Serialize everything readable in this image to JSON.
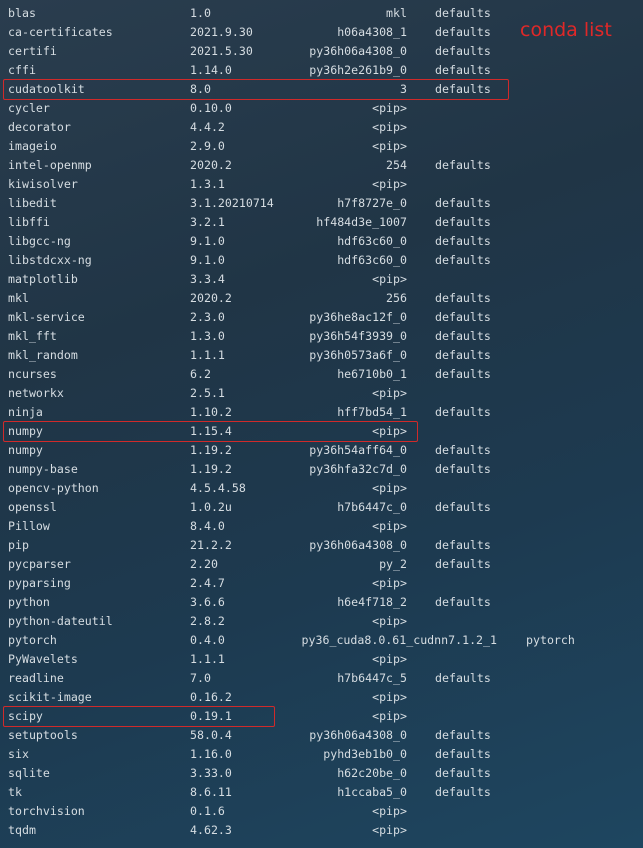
{
  "caption": "conda list",
  "packages": [
    {
      "name": "blas",
      "version": "1.0",
      "build": "mkl",
      "channel": "defaults"
    },
    {
      "name": "ca-certificates",
      "version": "2021.9.30",
      "build": "h06a4308_1",
      "channel": "defaults"
    },
    {
      "name": "certifi",
      "version": "2021.5.30",
      "build": "py36h06a4308_0",
      "channel": "defaults"
    },
    {
      "name": "cffi",
      "version": "1.14.0",
      "build": "py36h2e261b9_0",
      "channel": "defaults"
    },
    {
      "name": "cudatoolkit",
      "version": "8.0",
      "build": "3",
      "channel": "defaults"
    },
    {
      "name": "cycler",
      "version": "0.10.0",
      "build": "<pip>",
      "channel": ""
    },
    {
      "name": "decorator",
      "version": "4.4.2",
      "build": "<pip>",
      "channel": ""
    },
    {
      "name": "imageio",
      "version": "2.9.0",
      "build": "<pip>",
      "channel": ""
    },
    {
      "name": "intel-openmp",
      "version": "2020.2",
      "build": "254",
      "channel": "defaults"
    },
    {
      "name": "kiwisolver",
      "version": "1.3.1",
      "build": "<pip>",
      "channel": ""
    },
    {
      "name": "libedit",
      "version": "3.1.20210714",
      "build": "h7f8727e_0",
      "channel": "defaults"
    },
    {
      "name": "libffi",
      "version": "3.2.1",
      "build": "hf484d3e_1007",
      "channel": "defaults"
    },
    {
      "name": "libgcc-ng",
      "version": "9.1.0",
      "build": "hdf63c60_0",
      "channel": "defaults"
    },
    {
      "name": "libstdcxx-ng",
      "version": "9.1.0",
      "build": "hdf63c60_0",
      "channel": "defaults"
    },
    {
      "name": "matplotlib",
      "version": "3.3.4",
      "build": "<pip>",
      "channel": ""
    },
    {
      "name": "mkl",
      "version": "2020.2",
      "build": "256",
      "channel": "defaults"
    },
    {
      "name": "mkl-service",
      "version": "2.3.0",
      "build": "py36he8ac12f_0",
      "channel": "defaults"
    },
    {
      "name": "mkl_fft",
      "version": "1.3.0",
      "build": "py36h54f3939_0",
      "channel": "defaults"
    },
    {
      "name": "mkl_random",
      "version": "1.1.1",
      "build": "py36h0573a6f_0",
      "channel": "defaults"
    },
    {
      "name": "ncurses",
      "version": "6.2",
      "build": "he6710b0_1",
      "channel": "defaults"
    },
    {
      "name": "networkx",
      "version": "2.5.1",
      "build": "<pip>",
      "channel": ""
    },
    {
      "name": "ninja",
      "version": "1.10.2",
      "build": "hff7bd54_1",
      "channel": "defaults"
    },
    {
      "name": "numpy",
      "version": "1.15.4",
      "build": "<pip>",
      "channel": ""
    },
    {
      "name": "numpy",
      "version": "1.19.2",
      "build": "py36h54aff64_0",
      "channel": "defaults"
    },
    {
      "name": "numpy-base",
      "version": "1.19.2",
      "build": "py36hfa32c7d_0",
      "channel": "defaults"
    },
    {
      "name": "opencv-python",
      "version": "4.5.4.58",
      "build": "<pip>",
      "channel": ""
    },
    {
      "name": "openssl",
      "version": "1.0.2u",
      "build": "h7b6447c_0",
      "channel": "defaults"
    },
    {
      "name": "Pillow",
      "version": "8.4.0",
      "build": "<pip>",
      "channel": ""
    },
    {
      "name": "pip",
      "version": "21.2.2",
      "build": "py36h06a4308_0",
      "channel": "defaults"
    },
    {
      "name": "pycparser",
      "version": "2.20",
      "build": "py_2",
      "channel": "defaults"
    },
    {
      "name": "pyparsing",
      "version": "2.4.7",
      "build": "<pip>",
      "channel": ""
    },
    {
      "name": "python",
      "version": "3.6.6",
      "build": "h6e4f718_2",
      "channel": "defaults"
    },
    {
      "name": "python-dateutil",
      "version": "2.8.2",
      "build": "<pip>",
      "channel": ""
    },
    {
      "name": "pytorch",
      "version": "0.4.0",
      "build": "py36_cuda8.0.61_cudnn7.1.2_1",
      "channel": "pytorch"
    },
    {
      "name": "PyWavelets",
      "version": "1.1.1",
      "build": "<pip>",
      "channel": ""
    },
    {
      "name": "readline",
      "version": "7.0",
      "build": "h7b6447c_5",
      "channel": "defaults"
    },
    {
      "name": "scikit-image",
      "version": "0.16.2",
      "build": "<pip>",
      "channel": ""
    },
    {
      "name": "scipy",
      "version": "0.19.1",
      "build": "<pip>",
      "channel": ""
    },
    {
      "name": "setuptools",
      "version": "58.0.4",
      "build": "py36h06a4308_0",
      "channel": "defaults"
    },
    {
      "name": "six",
      "version": "1.16.0",
      "build": "pyhd3eb1b0_0",
      "channel": "defaults"
    },
    {
      "name": "sqlite",
      "version": "3.33.0",
      "build": "h62c20be_0",
      "channel": "defaults"
    },
    {
      "name": "tk",
      "version": "8.6.11",
      "build": "h1ccaba5_0",
      "channel": "defaults"
    },
    {
      "name": "torchvision",
      "version": "0.1.6",
      "build": "<pip>",
      "channel": ""
    },
    {
      "name": "tqdm",
      "version": "4.62.3",
      "build": "<pip>",
      "channel": ""
    }
  ],
  "highlights": [
    {
      "package": "cudatoolkit",
      "version": "8.0"
    },
    {
      "package": "numpy",
      "version": "1.15.4"
    },
    {
      "package": "scipy",
      "version": "0.19.1"
    }
  ],
  "colors": {
    "text": "#d6dde2",
    "highlight": "#d02a2a",
    "caption": "#e02828"
  }
}
